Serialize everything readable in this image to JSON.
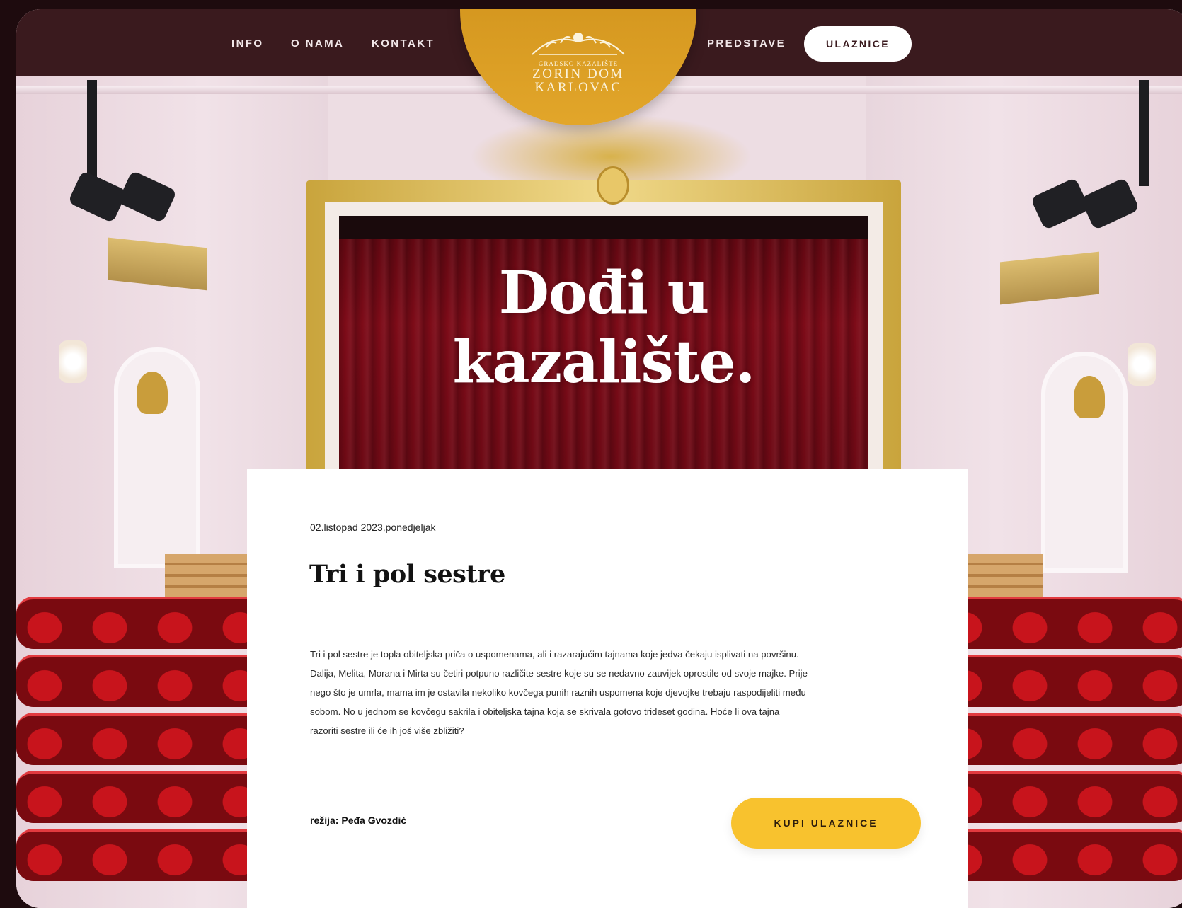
{
  "nav": {
    "left_links": [
      "INFO",
      "O NAMA",
      "KONTAKT"
    ],
    "right_link": "PREDSTAVE",
    "cta_label": "ULAZNICE"
  },
  "logo": {
    "line1": "GRADSKO KAZALIŠTE",
    "line2": "ZORIN DOM",
    "line3": "KARLOVAC"
  },
  "hero": {
    "title_line1": "Dođi u",
    "title_line2": "kazalište."
  },
  "event": {
    "date": "02.listopad 2023,ponedjeljak",
    "title": "Tri i pol sestre",
    "description_lines": [
      "Tri i pol sestre je topla obiteljska priča o uspomenama, ali i razarajućim tajnama koje jedva čekaju isplivati na površinu.",
      "Dalija, Melita, Morana i Mirta su četiri potpuno različite sestre koje su se nedavno zauvijek oprostile od svoje majke. Prije",
      "nego što je umrla, mama im je ostavila nekoliko kovčega punih raznih uspomena koje djevojke trebaju raspodijeliti među",
      "sobom. No u jednom se kovčegu sakrila i obiteljska tajna koja se skrivala gotovo trideset godina. Hoće li ova tajna",
      "razoriti sestre ili će ih još više zbližiti?"
    ],
    "director": "režija: Peđa Gvozdić",
    "buy_label": "KUPI ULAZNICE"
  },
  "colors": {
    "nav_bg": "#3a1a1e",
    "logo_gold": "#d99a1f",
    "cta_yellow": "#f8c22e",
    "curtain_red": "#7d0b18"
  }
}
